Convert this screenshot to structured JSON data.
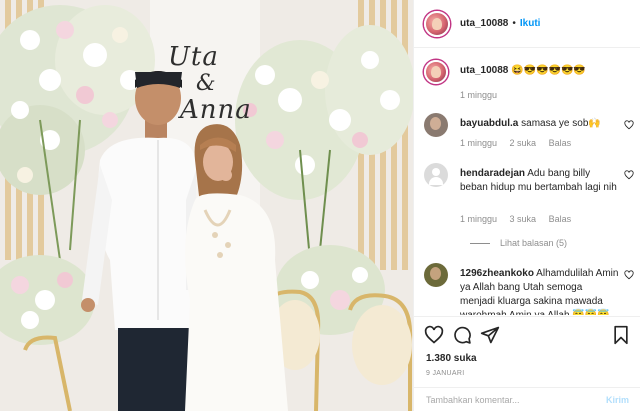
{
  "post": {
    "username": "uta_10088",
    "follow_label": "Ikuti",
    "separator": "•",
    "photo": {
      "sign_line1": "Uta",
      "sign_amp": "&",
      "sign_line2": "Anna"
    }
  },
  "caption": {
    "username": "uta_10088",
    "text": "😆😎😎😎😎😎",
    "time": "1 minggu"
  },
  "comments": [
    {
      "username": "bayuabdul.a",
      "text": "samasa ye sob🙌",
      "time": "1 minggu",
      "likes": "2 suka",
      "reply": "Balas",
      "avatar_color": "#8a7a70"
    },
    {
      "username": "hendaradejan",
      "text": "Adu bang billy beban hidup mu bertambah lagi nih",
      "time": "1 minggu",
      "likes": "3 suka",
      "reply": "Balas",
      "view_replies": "Lihat balasan (5)",
      "avatar_color": "#dbdbdb"
    },
    {
      "username": "1296zheankoko",
      "text": "Alhamdulilah Amin ya Allah bang Utah semoga menjadi kluarga sakina mawada warohmah Amin ya Allah 😇😇😇",
      "avatar_color": "#6c6a3a"
    }
  ],
  "actions": {
    "likes": "1.380 suka",
    "date": "9 JANUARI",
    "comment_placeholder": "Tambahkan komentar...",
    "post_label": "Kirim"
  },
  "colors": {
    "accent": "#0095f6",
    "muted": "#8e8e8e",
    "text": "#262626"
  },
  "icons": {
    "like": "heart-icon",
    "comment": "comment-bubble-icon",
    "share": "paper-plane-icon",
    "save": "bookmark-icon",
    "comment_like": "heart-icon"
  }
}
